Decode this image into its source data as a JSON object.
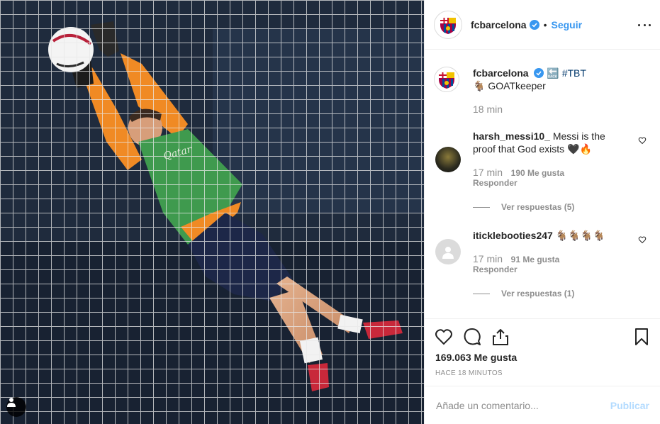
{
  "post": {
    "author": "fcbarcelona",
    "follow_label": "Seguir",
    "dot": "•",
    "caption": {
      "username": "fcbarcelona",
      "line1": "🔙 #TBT",
      "line2": "🐐 GOATkeeper",
      "time": "18 min"
    },
    "comments": [
      {
        "username": "harsh_messi10_",
        "text_line1": "Messi is the",
        "text_line2": "proof that God exists 🖤🔥",
        "time": "17 min",
        "likes": "190 Me gusta",
        "reply": "Responder",
        "view_replies": "Ver respuestas (5)"
      },
      {
        "username": "iticklebooties247",
        "text": "🐐🐐🐐🐐",
        "time": "17 min",
        "likes": "91 Me gusta",
        "reply": "Responder",
        "view_replies": "Ver respuestas (1)"
      }
    ],
    "like_count": "169.063 Me gusta",
    "posted_ago": "HACE 18 MINUTOS",
    "comment_placeholder": "Añade un comentario...",
    "publish_label": "Publicar"
  },
  "icons": {
    "verified": "verified-badge-icon",
    "more": "more-options-icon",
    "heart": "heart-icon",
    "comment": "comment-bubble-icon",
    "share": "share-icon",
    "save": "bookmark-icon",
    "tag": "tagged-user-icon"
  },
  "colors": {
    "accent": "#3897f0",
    "publish_disabled": "#b3dbff",
    "muted": "#8e8e8e",
    "shirt": "#f08a24",
    "bib": "#3f9a4e"
  }
}
